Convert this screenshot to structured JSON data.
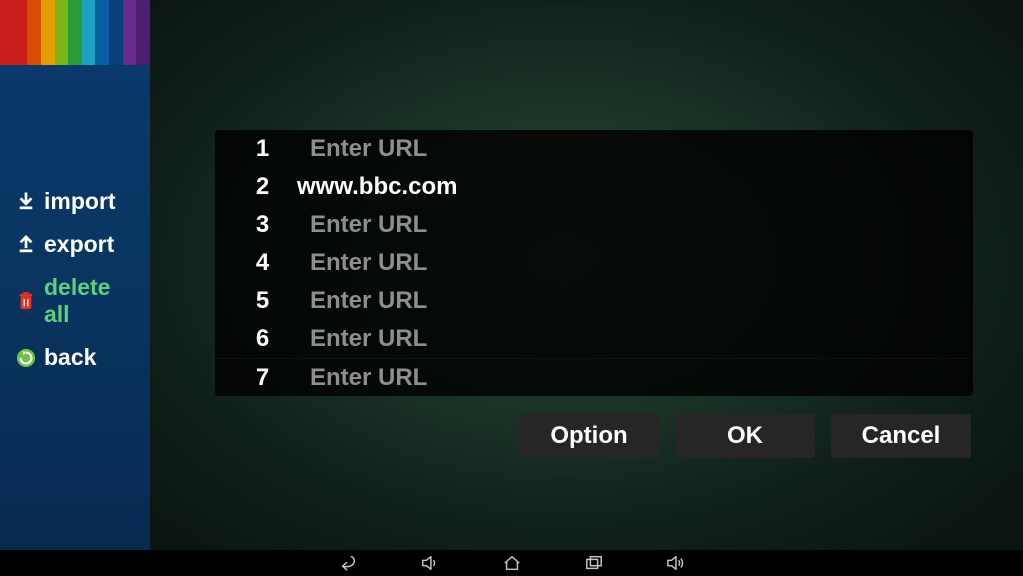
{
  "sidebar": {
    "logo_colors": [
      "#c81e1e",
      "#c81e1e",
      "#d84e00",
      "#e2a000",
      "#7cb518",
      "#2a9d3a",
      "#1fa0c4",
      "#0a5fa3",
      "#0a3f7a",
      "#6a2c8a",
      "#4a1e70"
    ],
    "items": [
      {
        "label": "import",
        "highlight": false
      },
      {
        "label": "export",
        "highlight": false
      },
      {
        "label": "delete all",
        "highlight": true
      },
      {
        "label": "back",
        "highlight": false
      }
    ]
  },
  "main": {
    "placeholder": "Enter URL",
    "rows": [
      {
        "num": "1",
        "value": "",
        "filled": false
      },
      {
        "num": "2",
        "value": "www.bbc.com",
        "filled": true
      },
      {
        "num": "3",
        "value": "",
        "filled": false
      },
      {
        "num": "4",
        "value": "",
        "filled": false
      },
      {
        "num": "5",
        "value": "",
        "filled": false
      },
      {
        "num": "6",
        "value": "",
        "filled": false
      },
      {
        "num": "7",
        "value": "",
        "filled": false
      }
    ],
    "buttons": {
      "option": "Option",
      "ok": "OK",
      "cancel": "Cancel"
    }
  }
}
